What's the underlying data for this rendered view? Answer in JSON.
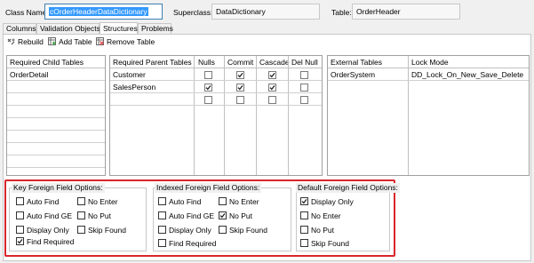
{
  "header": {
    "class_name_label": "Class Name:",
    "class_name_value": "cOrderHeaderDataDictionary",
    "superclass_label": "Superclass:",
    "superclass_value": "DataDictionary",
    "table_label": "Table:",
    "table_value": "OrderHeader"
  },
  "tabs": [
    {
      "label": "Columns",
      "active": false
    },
    {
      "label": "Validation Objects",
      "active": false
    },
    {
      "label": "Structures",
      "active": true
    },
    {
      "label": "Problems",
      "active": false
    }
  ],
  "toolbar": {
    "rebuild": "Rebuild",
    "add_table": "Add Table",
    "remove_table": "Remove Table"
  },
  "child_tables": {
    "header": "Required Child Tables",
    "rows": [
      "OrderDetail"
    ]
  },
  "parent_tables": {
    "headers": [
      "Required Parent Tables",
      "Nulls",
      "Commit",
      "Cascade",
      "Del Null"
    ],
    "rows": [
      {
        "name": "Customer",
        "nulls": false,
        "commit": true,
        "cascade": true,
        "del_null": false
      },
      {
        "name": "SalesPerson",
        "nulls": true,
        "commit": true,
        "cascade": true,
        "del_null": false
      },
      {
        "name": "",
        "nulls": false,
        "commit": false,
        "cascade": false,
        "del_null": false
      }
    ]
  },
  "external_tables": {
    "headers": [
      "External Tables",
      "Lock Mode"
    ],
    "rows": [
      {
        "name": "OrderSystem",
        "lock_mode": "DD_Lock_On_New_Save_Delete"
      }
    ]
  },
  "key_options": {
    "title": "Key Foreign Field Options:",
    "auto_find": "Auto Find",
    "auto_find_ge": "Auto Find GE",
    "display_only": "Display Only",
    "find_required": "Find Required",
    "no_enter": "No Enter",
    "no_put": "No Put",
    "skip_found": "Skip Found",
    "checked": {
      "find_required": true
    }
  },
  "indexed_options": {
    "title": "Indexed Foreign Field Options:",
    "auto_find": "Auto Find",
    "auto_find_ge": "Auto Find GE",
    "display_only": "Display Only",
    "find_required": "Find Required",
    "no_enter": "No Enter",
    "no_put": "No Put",
    "skip_found": "Skip Found",
    "checked": {
      "no_put": true
    }
  },
  "default_options": {
    "title": "Default Foreign Field Options:",
    "display_only": "Display Only",
    "no_enter": "No Enter",
    "no_put": "No Put",
    "skip_found": "Skip Found",
    "checked": {
      "display_only": true
    }
  },
  "colors": {
    "highlight_frame": "#d8262c",
    "selection": "#3399ff"
  }
}
